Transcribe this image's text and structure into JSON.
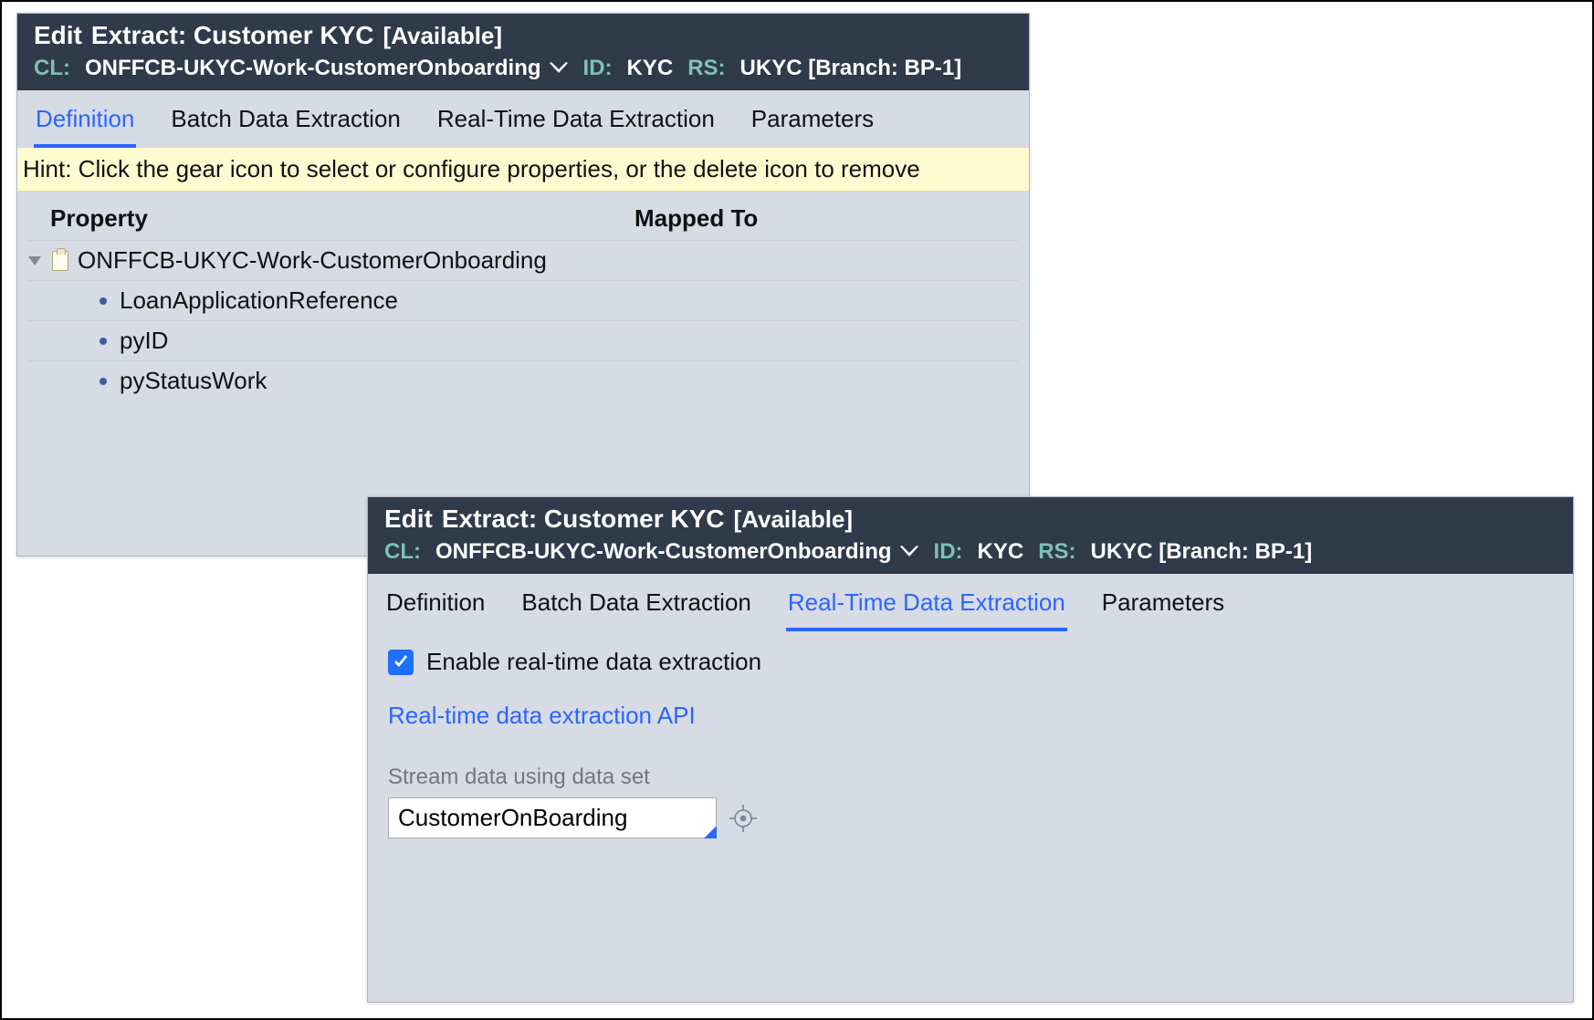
{
  "panel1": {
    "header": {
      "edit": "Edit",
      "title": "Extract: Customer KYC",
      "status": "[Available]",
      "cl_label": "CL:",
      "cl_value": "ONFFCB-UKYC-Work-CustomerOnboarding",
      "id_label": "ID:",
      "id_value": "KYC",
      "rs_label": "RS:",
      "rs_value": "UKYC [Branch: BP-1]"
    },
    "tabs": [
      "Definition",
      "Batch Data Extraction",
      "Real-Time Data Extraction",
      "Parameters"
    ],
    "active_tab_index": 0,
    "hint": "Hint: Click the gear icon to select or configure properties, or the delete icon to remove",
    "columns": {
      "property": "Property",
      "mapped_to": "Mapped To"
    },
    "tree": {
      "root": "ONFFCB-UKYC-Work-CustomerOnboarding",
      "children": [
        "LoanApplicationReference",
        "pyID",
        "pyStatusWork"
      ]
    }
  },
  "panel2": {
    "header": {
      "edit": "Edit",
      "title": "Extract: Customer KYC",
      "status": "[Available]",
      "cl_label": "CL:",
      "cl_value": "ONFFCB-UKYC-Work-CustomerOnboarding",
      "id_label": "ID:",
      "id_value": "KYC",
      "rs_label": "RS:",
      "rs_value": "UKYC [Branch: BP-1]"
    },
    "tabs": [
      "Definition",
      "Batch Data Extraction",
      "Real-Time Data Extraction",
      "Parameters"
    ],
    "active_tab_index": 2,
    "realtime": {
      "checkbox_label": "Enable real-time data extraction",
      "api_link": "Real-time data extraction API",
      "stream_label": "Stream data using data set",
      "stream_value": "CustomerOnBoarding"
    }
  }
}
